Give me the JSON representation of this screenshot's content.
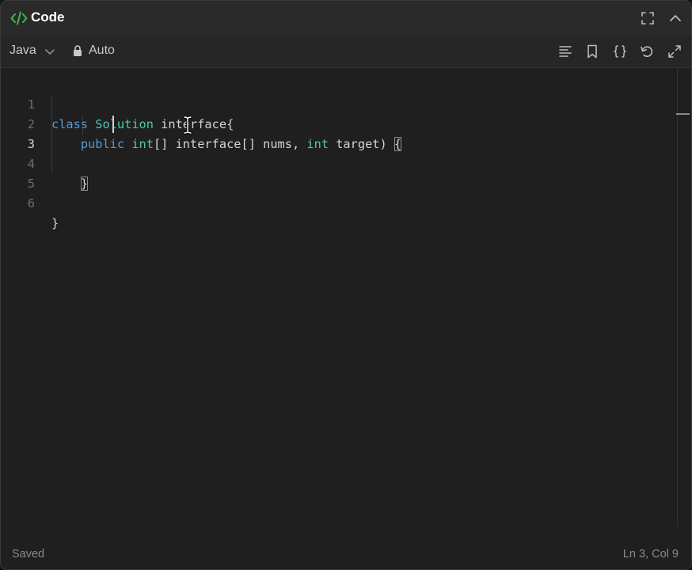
{
  "header": {
    "title": "Code",
    "title_icon": "code-brackets-icon",
    "fullscreen_icon": "fullscreen-icon",
    "collapse_icon": "chevron-up-icon"
  },
  "toolbar": {
    "language": "Java",
    "language_icon": "chevron-down-icon",
    "mode_icon": "lock-icon",
    "mode_label": "Auto",
    "tools": [
      "format-lines-icon",
      "bookmark-icon",
      "braces-icon",
      "reset-icon",
      "expand-icon"
    ]
  },
  "editor": {
    "line_numbers": [
      "1",
      "2",
      "3",
      "4",
      "5",
      "6"
    ],
    "active_line": "3",
    "lines": {
      "l1_t1": "class",
      "l1_t2": "Solution",
      "l1_t3": " interface{",
      "l2_t1": "public",
      "l2_t2": "int",
      "l2_t3": "[] interface[] nums, ",
      "l2_t4": "int",
      "l2_t5": " target) ",
      "l2_t6": "{",
      "l4_t1": "}",
      "l6_t1": "}"
    }
  },
  "status": {
    "saved": "Saved",
    "position": "Ln 3, Col 9"
  },
  "colors": {
    "accent_green": "#3fb950",
    "keyword": "#569cd6",
    "type": "#4ec9b0",
    "background": "#1f1f1f"
  }
}
